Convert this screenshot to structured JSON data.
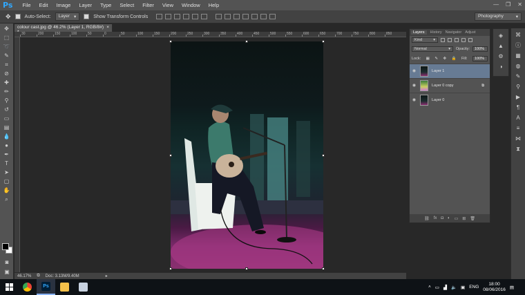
{
  "app": {
    "logo": "Ps"
  },
  "menu": [
    "File",
    "Edit",
    "Image",
    "Layer",
    "Type",
    "Select",
    "Filter",
    "View",
    "Window",
    "Help"
  ],
  "options_bar": {
    "auto_select_label": "Auto-Select:",
    "auto_select_target": "Layer",
    "show_transform_label": "Show Transform Controls"
  },
  "workspace": {
    "value": "Photography"
  },
  "document": {
    "tab_title": "colour cast.jpg @ 46.2% (Layer 1, RGB/8#) *",
    "close_glyph": "×",
    "zoom": "46.17%",
    "doc_size": "Doc: 3.13M/9.40M"
  },
  "ruler_labels": [
    "30",
    "200",
    "150",
    "100",
    "50",
    "0",
    "50",
    "100",
    "150",
    "200",
    "250",
    "300",
    "350",
    "400",
    "450",
    "500",
    "550",
    "600",
    "650",
    "700",
    "750",
    "800",
    "850"
  ],
  "layers_panel": {
    "tabs": [
      "Layers",
      "History",
      "Navigator",
      "Adjust"
    ],
    "filter_kind": "Kind",
    "blend_mode": "Normal",
    "opacity_label": "Opacity:",
    "opacity_value": "100%",
    "lock_label": "Lock:",
    "fill_label": "Fill:",
    "fill_value": "100%",
    "layers": [
      {
        "name": "Layer 1",
        "selected": true
      },
      {
        "name": "Layer 0 copy",
        "selected": false
      },
      {
        "name": "Layer 0",
        "selected": false
      }
    ],
    "bottom_icons": [
      "link-icon",
      "fx-icon",
      "mask-icon",
      "adjustment-icon",
      "group-icon",
      "new-layer-icon",
      "trash-icon"
    ]
  },
  "taskbar": {
    "language": "ENG",
    "time": "18:00",
    "date": "08/06/2016"
  }
}
